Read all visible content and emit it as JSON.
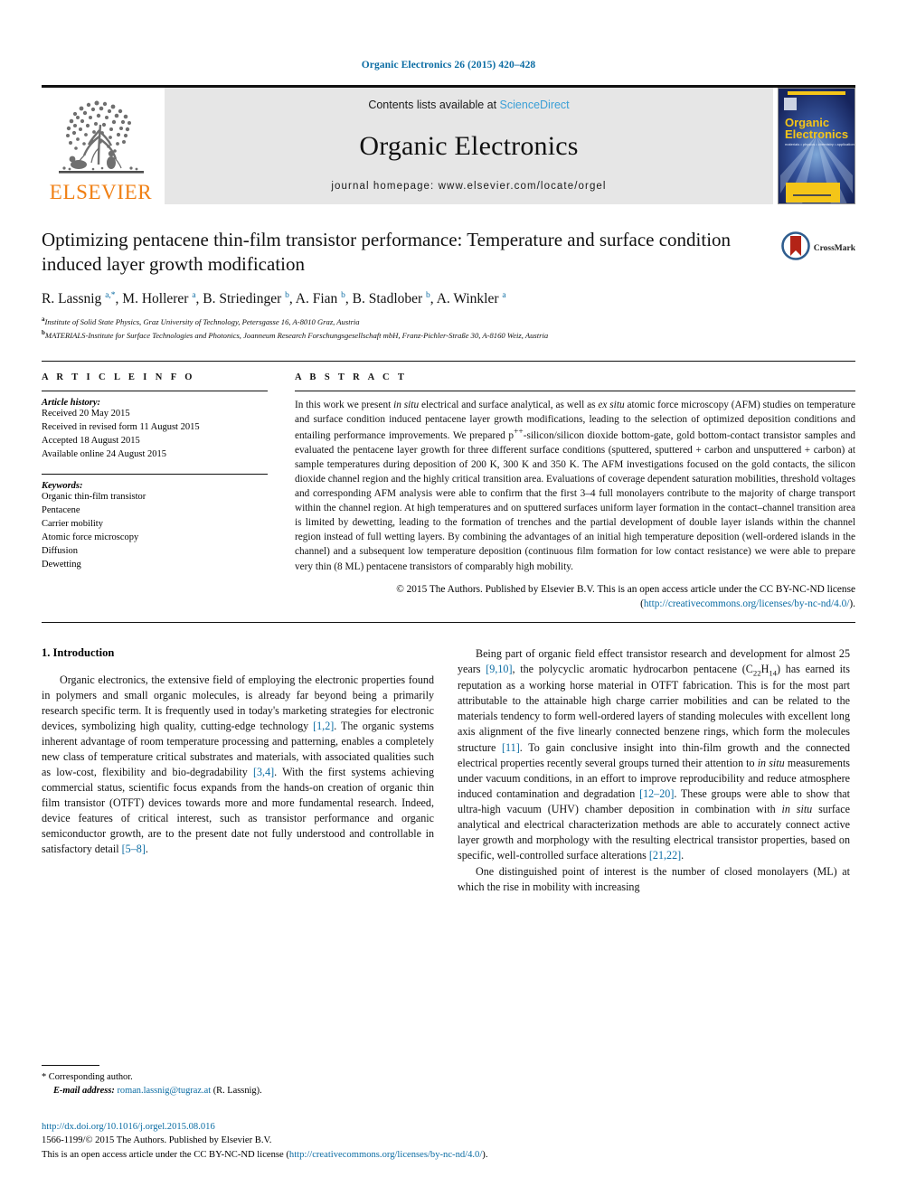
{
  "running_head": "Organic Electronics 26 (2015) 420–428",
  "masthead": {
    "publisher_name": "ELSEVIER",
    "contents_prefix": "Contents lists available at ",
    "sciencedirect": "ScienceDirect",
    "journal_title": "Organic Electronics",
    "homepage": "journal homepage: www.elsevier.com/locate/orgel",
    "cover": {
      "title_line1": "Organic",
      "title_line2": "Electronics",
      "subtitle": "materials • physics • chemistry • applications"
    },
    "colors": {
      "link_blue": "#3a9fd6",
      "elsevier_orange": "#f07f13",
      "band_gray": "#e6e6e6",
      "cover_blue": "#16245c",
      "cover_yellow": "#f4c518"
    }
  },
  "article": {
    "title": "Optimizing pentacene thin-film transistor performance: Temperature and surface condition induced layer growth modification",
    "crossmark_label": "CrossMark",
    "authors_html": "R. Lassnig <sup>a,*</sup>, M. Hollerer <sup>a</sup>, B. Striedinger <sup>b</sup>, A. Fian <sup>b</sup>, B. Stadlober <sup>b</sup>, A. Winkler <sup>a</sup>",
    "affiliations": [
      {
        "marker": "a",
        "text": "Institute of Solid State Physics, Graz University of Technology, Petersgasse 16, A-8010 Graz, Austria"
      },
      {
        "marker": "b",
        "text": "MATERIALS-Institute for Surface Technologies and Photonics, Joanneum Research Forschungsgesellschaft mbH, Franz-Pichler-Straße 30, A-8160 Weiz, Austria"
      }
    ]
  },
  "article_info": {
    "label": "A R T I C L E   I N F O",
    "history_label": "Article history:",
    "history": [
      "Received 20 May 2015",
      "Received in revised form 11 August 2015",
      "Accepted 18 August 2015",
      "Available online 24 August 2015"
    ],
    "keywords_label": "Keywords:",
    "keywords": [
      "Organic thin-film transistor",
      "Pentacene",
      "Carrier mobility",
      "Atomic force microscopy",
      "Diffusion",
      "Dewetting"
    ]
  },
  "abstract": {
    "label": "A B S T R A C T",
    "text_html": "In this work we present <i>in situ</i> electrical and surface analytical, as well as <i>ex situ</i> atomic force microscopy (AFM) studies on temperature and surface condition induced pentacene layer growth modifications, leading to the selection of optimized deposition conditions and entailing performance improvements. We prepared p<sup>++</sup>-silicon/silicon dioxide bottom-gate, gold bottom-contact transistor samples and evaluated the pentacene layer growth for three different surface conditions (sputtered, sputtered + carbon and unsputtered + carbon) at sample temperatures during deposition of 200 K, 300 K and 350 K. The AFM investigations focused on the gold contacts, the silicon dioxide channel region and the highly critical transition area. Evaluations of coverage dependent saturation mobilities, threshold voltages and corresponding AFM analysis were able to confirm that the first 3–4 full monolayers contribute to the majority of charge transport within the channel region. At high temperatures and on sputtered surfaces uniform layer formation in the contact–channel transition area is limited by dewetting, leading to the formation of trenches and the partial development of double layer islands within the channel region instead of full wetting layers. By combining the advantages of an initial high temperature deposition (well-ordered islands in the channel) and a subsequent low temperature deposition (continuous film formation for low contact resistance) we were able to prepare very thin (8 ML) pentacene transistors of comparably high mobility.",
    "copyright_prefix": "© 2015 The Authors. Published by Elsevier B.V. This is an open access article under the CC BY-NC-ND license (",
    "copyright_link": "http://creativecommons.org/licenses/by-nc-nd/4.0/",
    "copyright_suffix": ")."
  },
  "introduction": {
    "heading": "1. Introduction",
    "left_paragraphs_html": [
      "Organic electronics, the extensive field of employing the electronic properties found in polymers and small organic molecules, is already far beyond being a primarily research specific term. It is frequently used in today's marketing strategies for electronic devices, symbolizing high quality, cutting-edge technology <span class=\"link\">[1,2]</span>. The organic systems inherent advantage of room temperature processing and patterning, enables a completely new class of temperature critical substrates and materials, with associated qualities such as low-cost, flexibility and bio-degradability <span class=\"link\">[3,4]</span>. With the first systems achieving commercial status, scientific focus expands from the hands-on creation of organic thin film transistor (OTFT) devices towards more and more fundamental research. Indeed, device features of critical interest, such as transistor performance and organic semiconductor growth, are to the present date not fully understood and controllable in satisfactory detail <span class=\"link\">[5–8]</span>."
    ],
    "right_paragraphs_html": [
      "Being part of organic field effect transistor research and development for almost 25 years <span class=\"link\">[9,10]</span>, the polycyclic aromatic hydrocarbon pentacene (C<sub>22</sub>H<sub>14</sub>) has earned its reputation as a working horse material in OTFT fabrication. This is for the most part attributable to the attainable high charge carrier mobilities and can be related to the materials tendency to form well-ordered layers of standing molecules with excellent long axis alignment of the five linearly connected benzene rings, which form the molecules structure <span class=\"link\">[11]</span>. To gain conclusive insight into thin-film growth and the connected electrical properties recently several groups turned their attention to <i>in situ</i> measurements under vacuum conditions, in an effort to improve reproducibility and reduce atmosphere induced contamination and degradation <span class=\"link\">[12–20]</span>. These groups were able to show that ultra-high vacuum (UHV) chamber deposition in combination with <i>in situ</i> surface analytical and electrical characterization methods are able to accurately connect active layer growth and morphology with the resulting electrical transistor properties, based on specific, well-controlled surface alterations <span class=\"link\">[21,22]</span>.",
      "One distinguished point of interest is the number of closed monolayers (ML) at which the rise in mobility with increasing"
    ]
  },
  "footnote": {
    "corresponding": "* Corresponding author.",
    "email_label": "E-mail address:",
    "email": "roman.lassnig@tugraz.at",
    "email_owner": "(R. Lassnig)."
  },
  "footer": {
    "doi": "http://dx.doi.org/10.1016/j.orgel.2015.08.016",
    "issn_line": "1566-1199/© 2015 The Authors. Published by Elsevier B.V.",
    "license_prefix": "This is an open access article under the CC BY-NC-ND license (",
    "license_link": "http://creativecommons.org/licenses/by-nc-nd/4.0/",
    "license_suffix": ")."
  }
}
